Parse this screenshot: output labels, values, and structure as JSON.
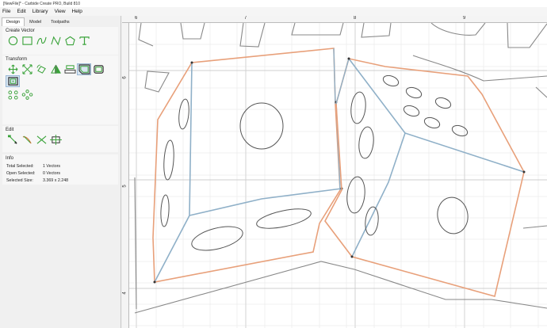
{
  "window": {
    "title": "[NewFile]* - Carbide Create PRO, Build 810"
  },
  "menu": [
    "File",
    "Edit",
    "Library",
    "View",
    "Help"
  ],
  "tabs": [
    {
      "label": "Design",
      "active": true
    },
    {
      "label": "Model",
      "active": false
    },
    {
      "label": "Toolpaths",
      "active": false
    }
  ],
  "sections": {
    "create_vector": "Create Vector",
    "transform": "Transform",
    "edit": "Edit",
    "info": "Info"
  },
  "create_vector_tools": [
    "circle-icon",
    "rectangle-icon",
    "curve-icon",
    "polyline-icon",
    "polygon-icon",
    "text-icon"
  ],
  "transform_tools": [
    "move-icon",
    "scale-icon",
    "rotate-icon",
    "mirror-icon",
    "align-icon",
    "offset-icon",
    "boolean-icon",
    "join-icon",
    "array-icon",
    "circular-array-icon"
  ],
  "edit_tools": [
    "node-edit-icon",
    "trim-icon",
    "cut-icon",
    "box-select-icon"
  ],
  "info": {
    "total_selected_label": "Total Selected:",
    "total_selected_value": "1 Vectors",
    "open_selected_label": "Open Selected:",
    "open_selected_value": "0 Vectors",
    "selected_size_label": "Selected Size:",
    "selected_size_value": "3.369 x 2.248"
  },
  "ruler": {
    "x_labels": [
      "6",
      "7",
      "8",
      "9"
    ],
    "y_labels": [
      "6",
      "5",
      "4"
    ]
  },
  "colors": {
    "selection_outline": "#e8a07a",
    "selected_fill_edge": "#8fb0c8",
    "vector_stroke": "#444444",
    "tool_green": "#3aa33a",
    "grid": "#e4e4e4"
  }
}
